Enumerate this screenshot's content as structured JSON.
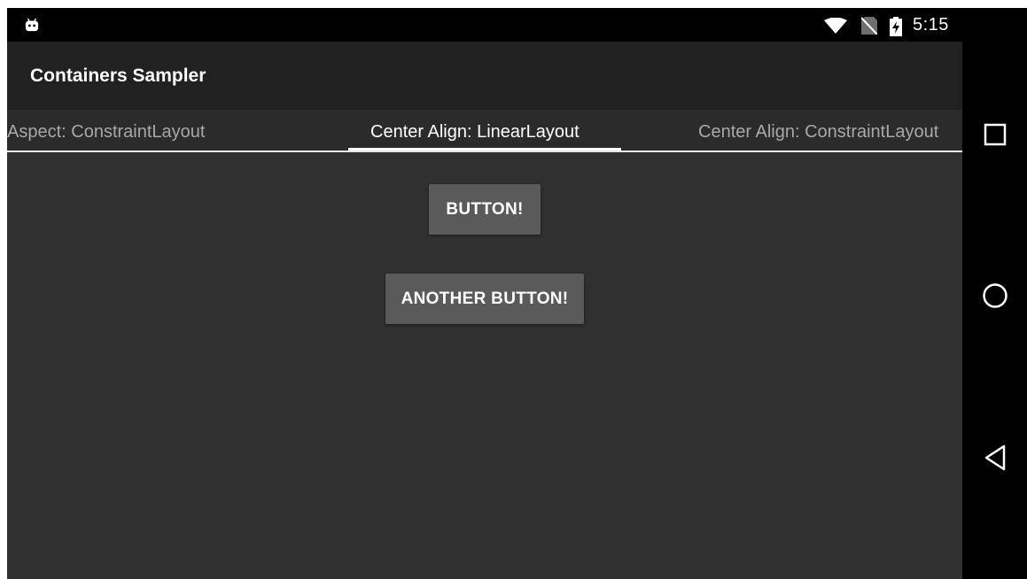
{
  "status_bar": {
    "app_icon": "android-icon",
    "wifi_icon": "wifi-icon",
    "sim_icon": "no-sim-icon",
    "battery_icon": "battery-charging-icon",
    "time": "5:15"
  },
  "toolbar": {
    "title": "Containers Sampler"
  },
  "tabs": [
    {
      "label": "Aspect: ConstraintLayout",
      "active": false
    },
    {
      "label": "Center Align: LinearLayout",
      "active": true
    },
    {
      "label": "Center Align: ConstraintLayout",
      "active": false
    }
  ],
  "content": {
    "button_1_label": "BUTTON!",
    "button_2_label": "ANOTHER BUTTON!"
  },
  "nav_bar": {
    "recents_icon": "recents-square-icon",
    "home_icon": "home-circle-icon",
    "back_icon": "back-triangle-icon"
  },
  "colors": {
    "background": "#303030",
    "toolbar": "#212121",
    "tab_bar": "#2b2b2b",
    "button": "#5a5a5a",
    "system_bars": "#000000"
  }
}
